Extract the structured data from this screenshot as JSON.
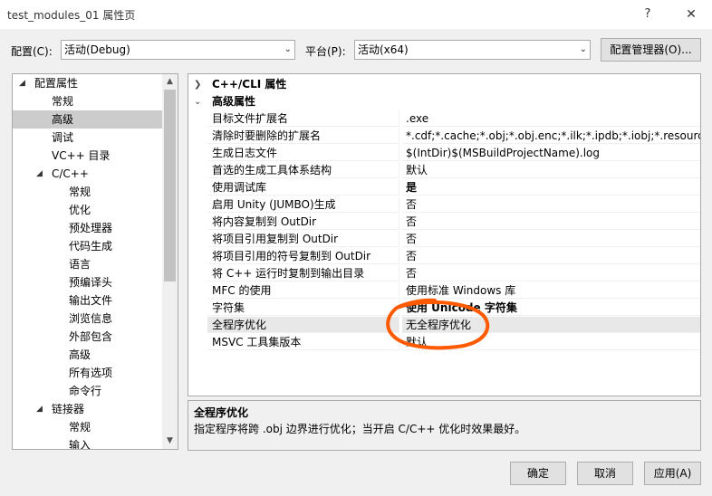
{
  "window": {
    "title": "test_modules_01 属性页",
    "help_glyph": "?",
    "close_glyph": "✕"
  },
  "toolbar": {
    "config_label": "配置(C):",
    "config_value": "活动(Debug)",
    "platform_label": "平台(P):",
    "platform_value": "活动(x64)",
    "config_manager_label": "配置管理器(O)..."
  },
  "tree": {
    "items": [
      {
        "label": "配置属性",
        "level": 0,
        "expanded": true
      },
      {
        "label": "常规",
        "level": 1
      },
      {
        "label": "高级",
        "level": 1,
        "selected": true
      },
      {
        "label": "调试",
        "level": 1
      },
      {
        "label": "VC++ 目录",
        "level": 1
      },
      {
        "label": "C/C++",
        "level": 1,
        "expanded": true
      },
      {
        "label": "常规",
        "level": 2
      },
      {
        "label": "优化",
        "level": 2
      },
      {
        "label": "预处理器",
        "level": 2
      },
      {
        "label": "代码生成",
        "level": 2
      },
      {
        "label": "语言",
        "level": 2
      },
      {
        "label": "预编译头",
        "level": 2
      },
      {
        "label": "输出文件",
        "level": 2
      },
      {
        "label": "浏览信息",
        "level": 2
      },
      {
        "label": "外部包含",
        "level": 2
      },
      {
        "label": "高级",
        "level": 2
      },
      {
        "label": "所有选项",
        "level": 2
      },
      {
        "label": "命令行",
        "level": 2
      },
      {
        "label": "链接器",
        "level": 1,
        "expanded": true
      },
      {
        "label": "常规",
        "level": 2
      },
      {
        "label": "输入",
        "level": 2
      }
    ]
  },
  "grid": {
    "categories": [
      {
        "label": "C++/CLI 属性",
        "expanded": false
      },
      {
        "label": "高级属性",
        "expanded": true
      }
    ],
    "rows": [
      {
        "name": "目标文件扩展名",
        "value": ".exe"
      },
      {
        "name": "清除时要删除的扩展名",
        "value": "*.cdf;*.cache;*.obj;*.obj.enc;*.ilk;*.ipdb;*.iobj;*.resources;*"
      },
      {
        "name": "生成日志文件",
        "value": "$(IntDir)$(MSBuildProjectName).log"
      },
      {
        "name": "首选的生成工具体系结构",
        "value": "默认"
      },
      {
        "name": "使用调试库",
        "value": "是",
        "bold": true
      },
      {
        "name": "启用 Unity (JUMBO)生成",
        "value": "否"
      },
      {
        "name": "将内容复制到 OutDir",
        "value": "否"
      },
      {
        "name": "将项目引用复制到 OutDir",
        "value": "否"
      },
      {
        "name": "将项目引用的符号复制到 OutDir",
        "value": "否"
      },
      {
        "name": "将 C++ 运行时复制到输出目录",
        "value": "否"
      },
      {
        "name": "MFC 的使用",
        "value": "使用标准 Windows 库"
      },
      {
        "name": "字符集",
        "value": "使用 Unicode 字符集",
        "bold": true
      },
      {
        "name": "全程序优化",
        "value": "无全程序优化",
        "selected": true
      },
      {
        "name": "MSVC 工具集版本",
        "value": "默认"
      }
    ]
  },
  "description": {
    "title": "全程序优化",
    "text": "指定程序将跨 .obj 边界进行优化；当开启 C/C++ 优化时效果最好。"
  },
  "buttons": {
    "ok": "确定",
    "cancel": "取消",
    "apply": "应用(A)"
  },
  "colors": {
    "annotation": "#ff5a00",
    "selection": "#cccccc"
  }
}
